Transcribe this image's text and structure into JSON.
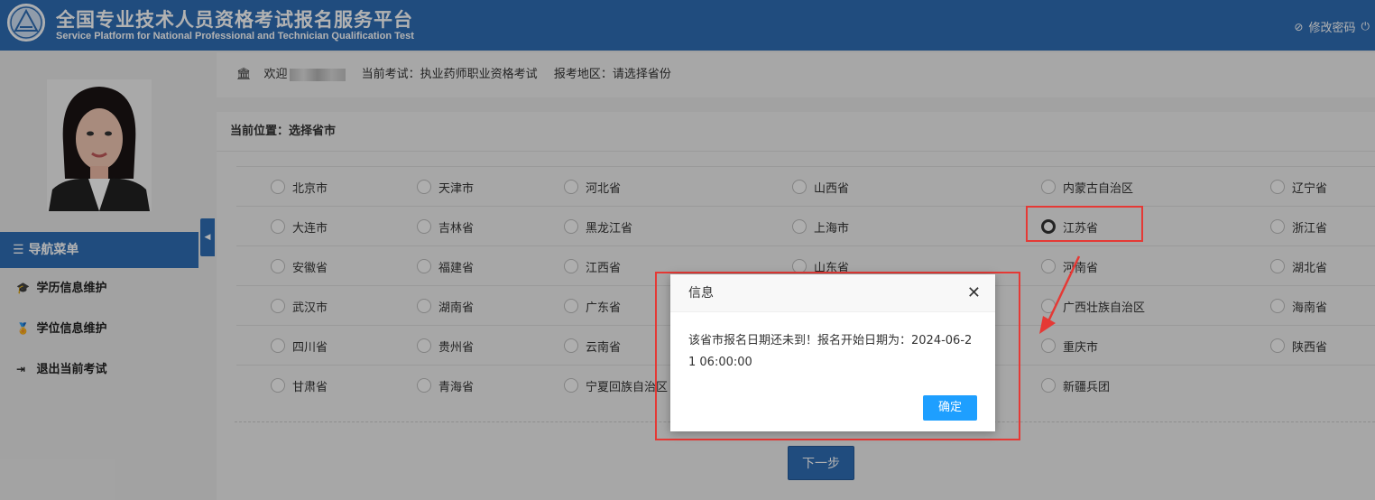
{
  "header": {
    "title_cn": "全国专业技术人员资格考试报名服务平台",
    "title_en": "Service Platform for National Professional and Technician Qualification Test",
    "change_password": "修改密码",
    "brand_color": "#2f6db5"
  },
  "sidebar": {
    "nav_title": "导航菜单",
    "items": [
      {
        "label": "学历信息维护",
        "icon": "graduation-cap-icon"
      },
      {
        "label": "学位信息维护",
        "icon": "medal-icon"
      },
      {
        "label": "退出当前考试",
        "icon": "exit-icon"
      }
    ]
  },
  "topbar": {
    "welcome": "欢迎",
    "current_exam": "当前考试：执业药师职业资格考试",
    "region": "报考地区：请选择省份"
  },
  "breadcrumb": "当前位置：选择省市",
  "provinces": [
    [
      "北京市",
      "天津市",
      "河北省",
      "山西省",
      "内蒙古自治区",
      "辽宁省"
    ],
    [
      "大连市",
      "吉林省",
      "黑龙江省",
      "上海市",
      "江苏省",
      "浙江省"
    ],
    [
      "安徽省",
      "福建省",
      "江西省",
      "山东省",
      "河南省",
      "湖北省"
    ],
    [
      "武汉市",
      "湖南省",
      "广东省",
      "",
      "广西壮族自治区",
      "海南省"
    ],
    [
      "四川省",
      "贵州省",
      "云南省",
      "",
      "重庆市",
      "陕西省"
    ],
    [
      "甘肃省",
      "青海省",
      "宁夏回族自治区",
      "",
      "新疆兵团",
      ""
    ]
  ],
  "selected_province": "江苏省",
  "next_button": "下一步",
  "dialog": {
    "title": "信息",
    "message": "该省市报名日期还未到！报名开始日期为：2024-06-21 06:00:00",
    "ok": "确定",
    "ok_color": "#1e9fff"
  },
  "annotation_color": "#e53935"
}
